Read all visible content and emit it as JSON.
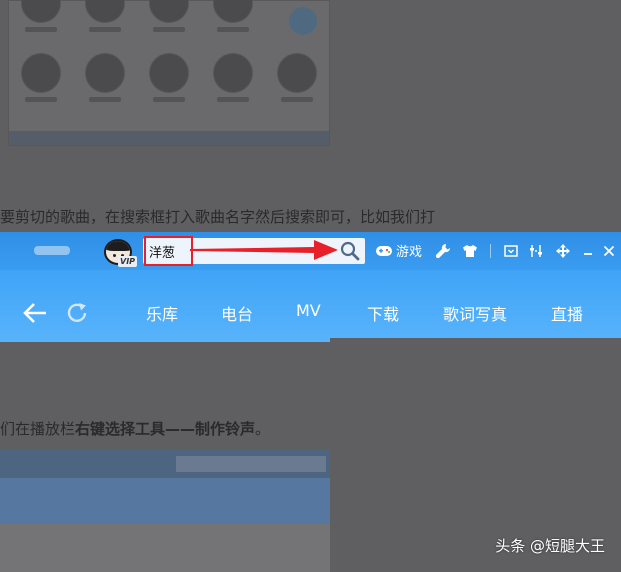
{
  "background": {
    "article_line_1": "要剪切的歌曲，在搜索框打入歌曲名字然后搜索即可，比如我们打",
    "article_line_2_prefix": "们在播放栏",
    "article_line_2_bold": "右键选择工具——制作铃声",
    "article_line_2_suffix": "。"
  },
  "player": {
    "vip_badge": "VIP",
    "search": {
      "value": "洋葱"
    },
    "toolbar": {
      "games_label": "游戏"
    },
    "nav": {
      "tabs": [
        {
          "label": "乐库"
        },
        {
          "label": "电台"
        },
        {
          "label": "MV"
        },
        {
          "label": "下载"
        },
        {
          "label": "歌词写真"
        },
        {
          "label": "直播"
        }
      ]
    }
  },
  "watermark": "头条 @短腿大王",
  "colors": {
    "topbar": "#3396eb",
    "navbar": "#4eacf9",
    "highlight_box": "#e8202a",
    "arrow": "#e8202a",
    "dim_overlay": "#5f5f61"
  },
  "icons": [
    "search-icon",
    "gamepad-icon",
    "wrench-icon",
    "tshirt-icon",
    "mini-mode-icon",
    "equalizer-icon",
    "move-icon",
    "minimize-icon",
    "close-icon",
    "back-arrow-icon",
    "refresh-icon"
  ]
}
